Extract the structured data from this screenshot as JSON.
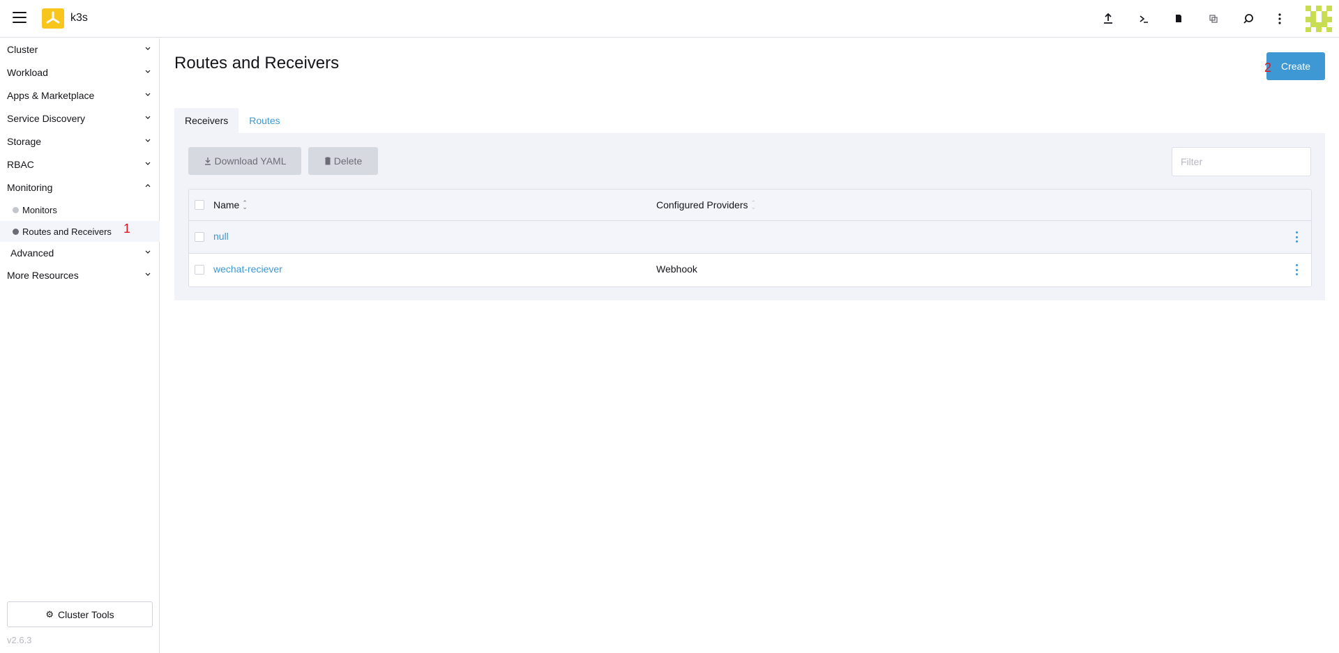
{
  "header": {
    "cluster_name": "k3s",
    "icons": [
      "upload-icon",
      "terminal-icon",
      "file-icon",
      "copy-icon",
      "search-icon",
      "more-vert-icon"
    ]
  },
  "sidebar": {
    "groups": [
      {
        "label": "Cluster",
        "expanded": false
      },
      {
        "label": "Workload",
        "expanded": false
      },
      {
        "label": "Apps & Marketplace",
        "expanded": false
      },
      {
        "label": "Service Discovery",
        "expanded": false
      },
      {
        "label": "Storage",
        "expanded": false
      },
      {
        "label": "RBAC",
        "expanded": false
      },
      {
        "label": "Monitoring",
        "expanded": true
      },
      {
        "label": "Advanced",
        "expanded": false
      },
      {
        "label": "More Resources",
        "expanded": false
      }
    ],
    "monitoring_items": [
      {
        "label": "Monitors",
        "active": false
      },
      {
        "label": "Routes and Receivers",
        "active": true
      }
    ],
    "annotation_1": "1",
    "cluster_tools_label": "Cluster Tools",
    "version": "v2.6.3"
  },
  "main": {
    "title": "Routes and Receivers",
    "create_label": "Create",
    "annotation_2": "2",
    "tabs": [
      {
        "label": "Receivers",
        "active": true
      },
      {
        "label": "Routes",
        "active": false
      }
    ],
    "download_label": "Download YAML",
    "delete_label": "Delete",
    "filter_placeholder": "Filter",
    "table": {
      "columns": [
        "Name",
        "Configured Providers"
      ],
      "rows": [
        {
          "name": "null",
          "providers": ""
        },
        {
          "name": "wechat-reciever",
          "providers": "Webhook"
        }
      ]
    }
  },
  "colors": {
    "accent": "#3d98d3",
    "logo": "#f8c51c",
    "annotation": "#e0151e"
  }
}
